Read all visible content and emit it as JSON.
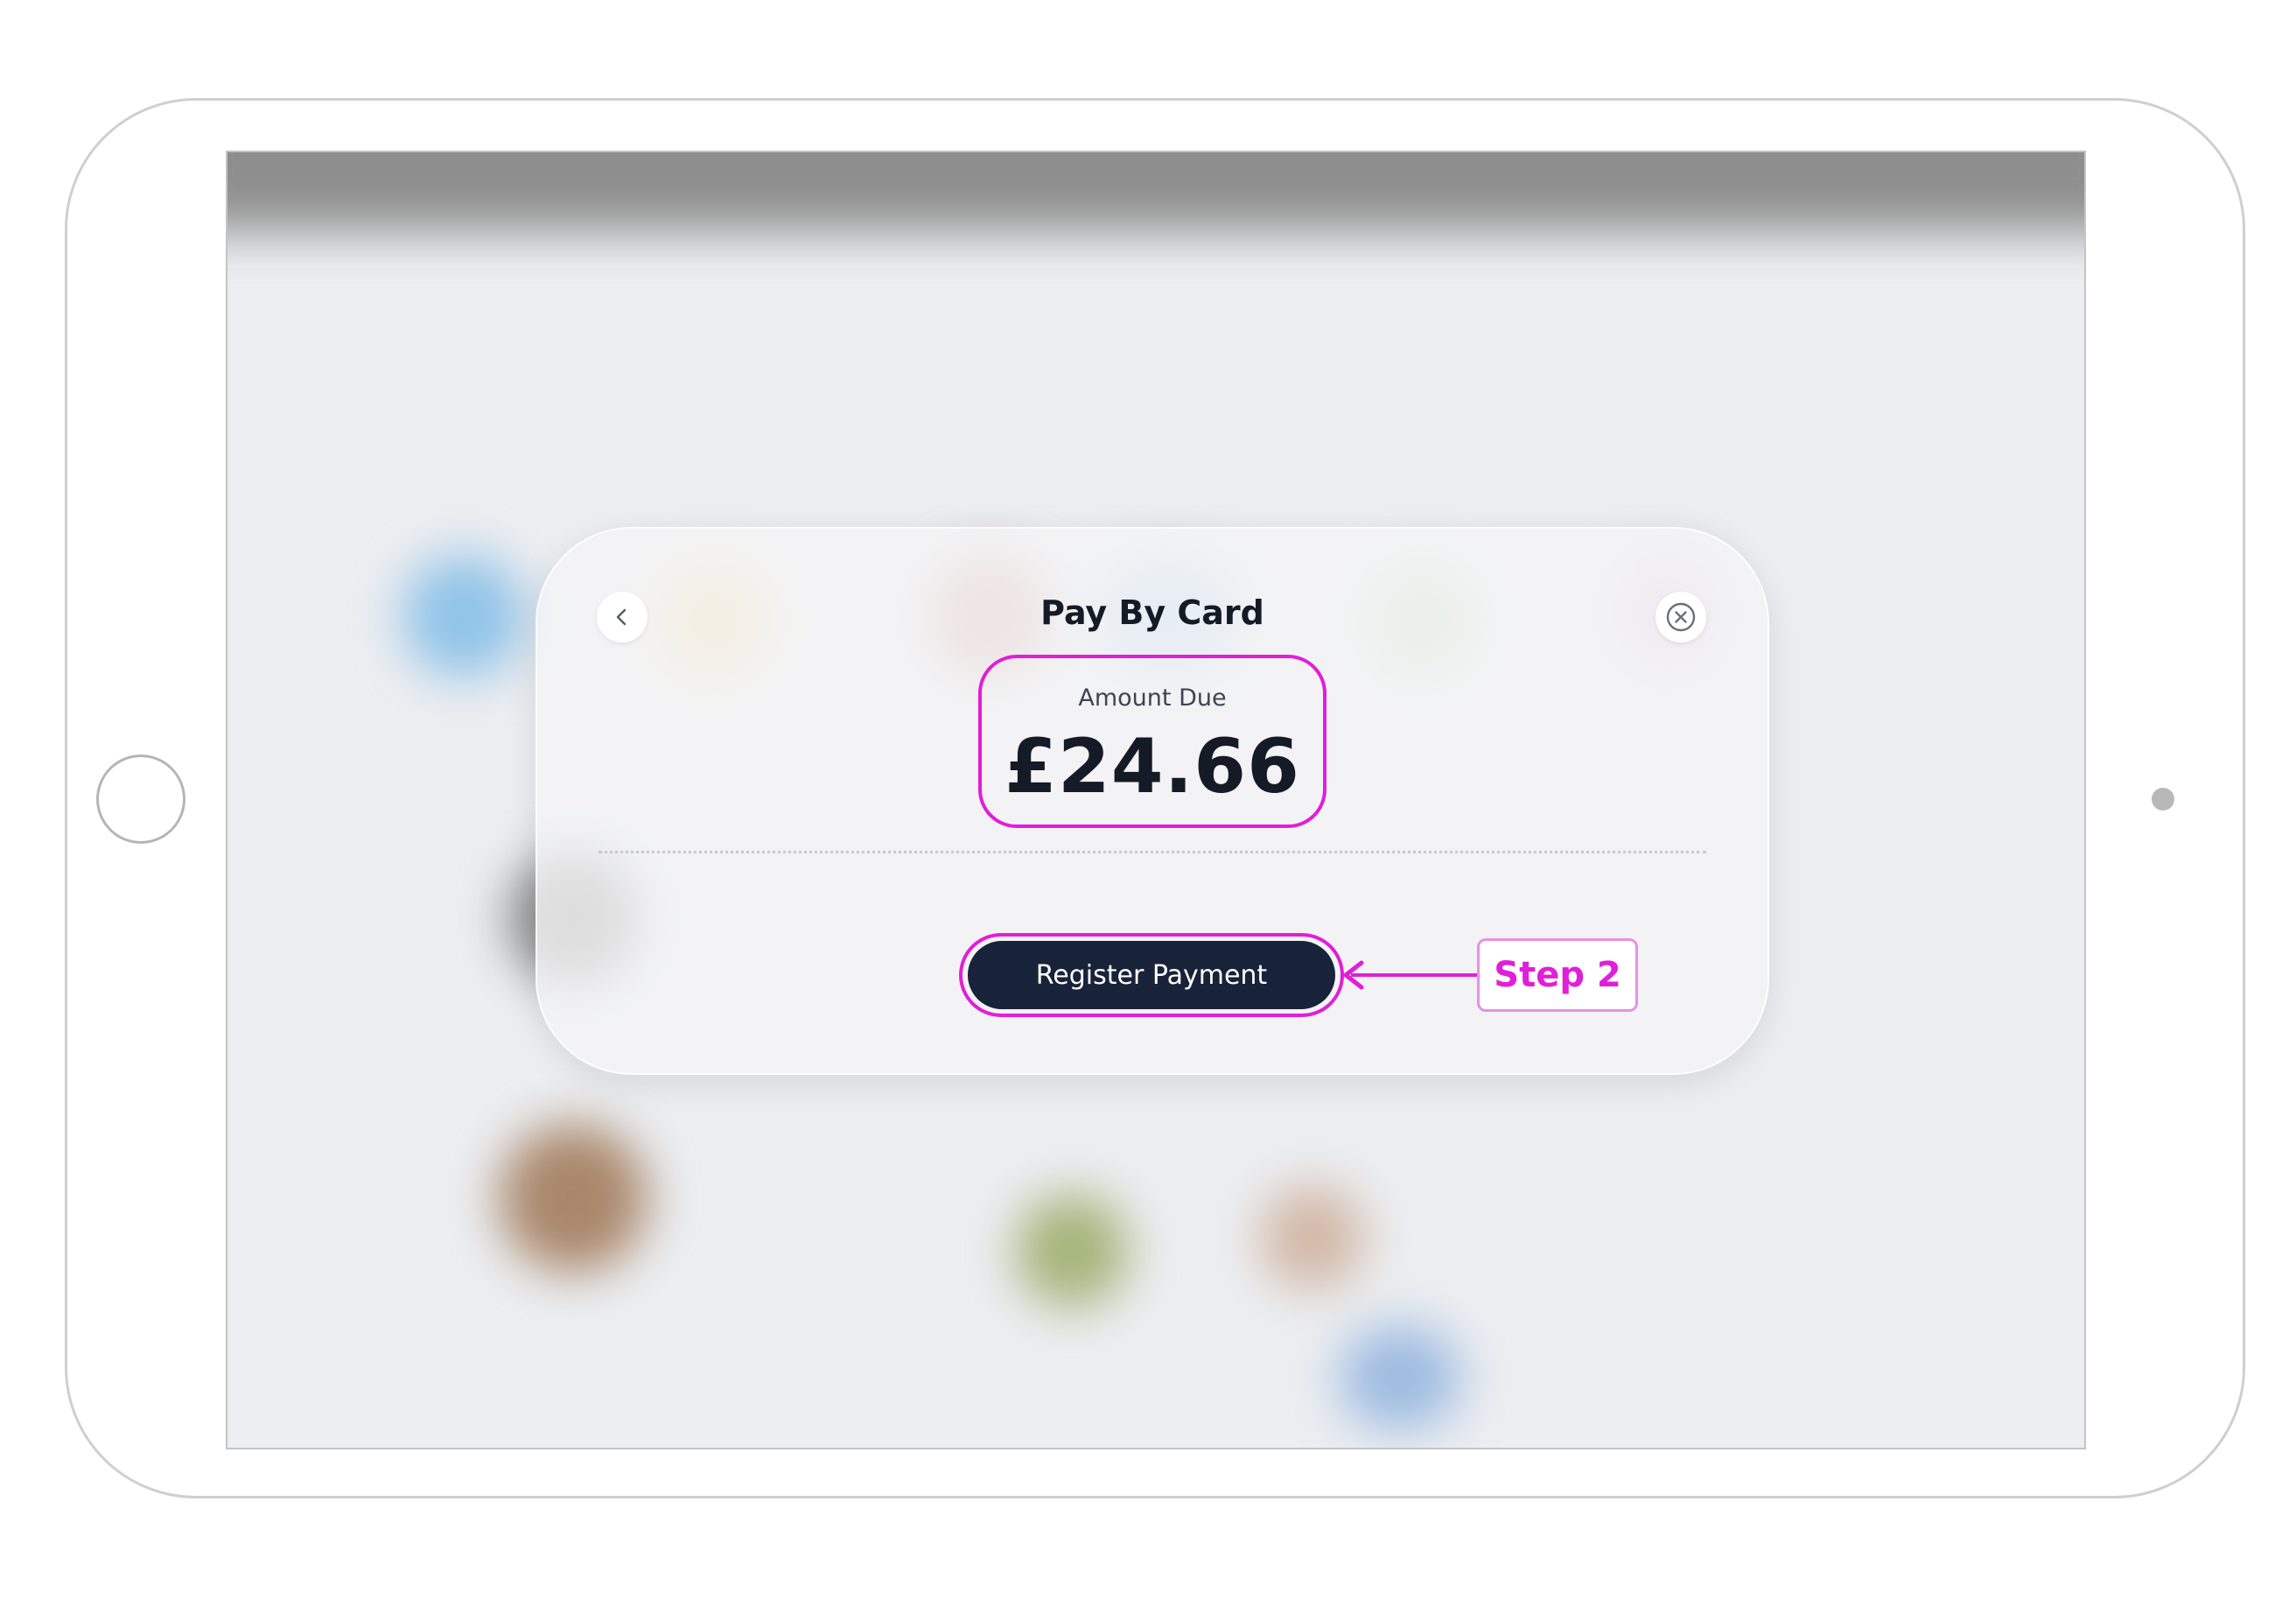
{
  "dialog": {
    "title": "Pay By Card",
    "amount_label": "Amount Due",
    "amount_value": "£24.66",
    "register_button_label": "Register Payment"
  },
  "annotation": {
    "step_label": "Step 2",
    "highlight_color": "#e11ed9"
  },
  "icons": {
    "back": "chevron-left-icon",
    "close": "close-circle-icon"
  },
  "colors": {
    "button_bg": "#18233a",
    "title_text": "#141a26"
  }
}
